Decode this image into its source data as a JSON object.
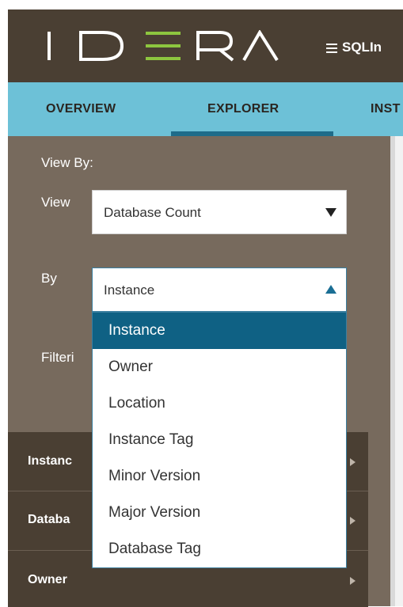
{
  "header": {
    "logo_text": "IDERA",
    "app_name": "SQLIn"
  },
  "tabs": [
    {
      "label": "OVERVIEW",
      "active": false
    },
    {
      "label": "EXPLORER",
      "active": true
    },
    {
      "label": "INST",
      "active": false
    }
  ],
  "sidebar": {
    "view_by_label": "View By:",
    "view_label": "View",
    "view_select_value": "Database Count",
    "by_label": "By",
    "by_select_value": "Instance",
    "filtering_label": "Filteri",
    "sections": [
      {
        "title": "Instanc"
      },
      {
        "title": "Databa"
      },
      {
        "title": "Owner"
      }
    ]
  },
  "dropdown": {
    "options": [
      {
        "label": "Instance",
        "selected": true
      },
      {
        "label": "Owner",
        "selected": false
      },
      {
        "label": "Location",
        "selected": false
      },
      {
        "label": "Instance Tag",
        "selected": false
      },
      {
        "label": "Minor Version",
        "selected": false
      },
      {
        "label": "Major Version",
        "selected": false
      },
      {
        "label": "Database Tag",
        "selected": false
      }
    ]
  },
  "colors": {
    "header_bg": "#4a3f33",
    "tab_bar_bg": "#6dc1d7",
    "tab_underline": "#1e6c8a",
    "sidebar_bg": "#776a5d",
    "logo_accent": "#8dc63f",
    "option_selected_bg": "#0f6184"
  },
  "icons": {
    "menu": "hamburger-icon",
    "select_closed": "caret-down-icon",
    "select_open": "caret-up-icon",
    "section_expand": "chevron-right-icon"
  }
}
